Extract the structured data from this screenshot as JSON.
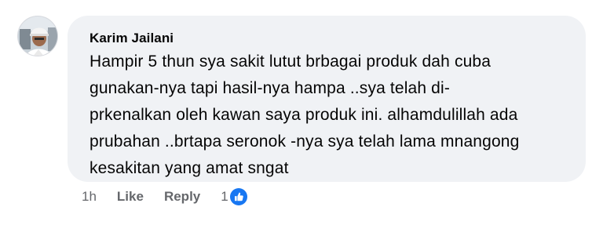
{
  "comment": {
    "author": "Karim Jailani",
    "lines": [
      "Hampir 5 thun sya sakit lutut brbagai produk dah cuba",
      "gunakan-nya tapi hasil-nya hampa ..sya telah di-",
      "prkenalkan oleh kawan saya produk ini. alhamdulillah ada",
      "prubahan ..brtapa seronok -nya sya telah lama mnangong",
      "kesakitan yang amat sngat"
    ],
    "time": "1h",
    "like_label": "Like",
    "reply_label": "Reply",
    "reaction_count": "1",
    "reaction_icon": "thumbs-up-icon",
    "colors": {
      "bubble": "#f0f2f5",
      "meta_text": "#65676b",
      "like_blue": "#1877f2"
    }
  }
}
